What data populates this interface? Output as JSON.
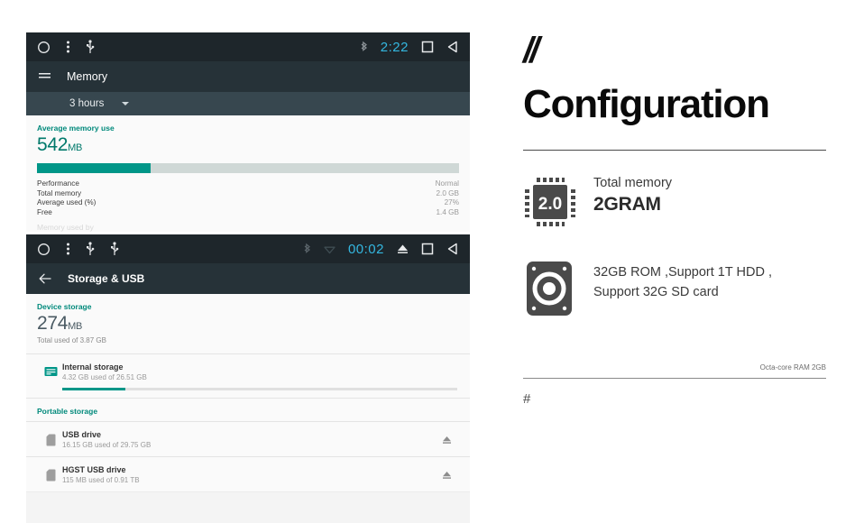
{
  "screenshot_memory": {
    "statusbar": {
      "home_icon": "circle-home-icon",
      "menu_icon": "overflow-menu-icon",
      "usb_icon": "usb-icon",
      "bluetooth_icon": "bluetooth-icon",
      "clock": "2:22",
      "recents_icon": "recents-square-icon",
      "back_icon": "back-triangle-icon"
    },
    "appbar": {
      "menu_icon": "hamburger-icon",
      "title": "Memory"
    },
    "spinner": {
      "value": "3 hours",
      "caret_icon": "chevron-down-icon"
    },
    "section_label": "Average memory use",
    "value": "542",
    "unit": "MB",
    "usage_percent": 27,
    "stats": [
      {
        "label": "Performance",
        "value": "Normal"
      },
      {
        "label": "Total memory",
        "value": "2.0 GB"
      },
      {
        "label": "Average used (%)",
        "value": "27%"
      },
      {
        "label": "Free",
        "value": "1.4 GB"
      }
    ],
    "cut_off_row": "Memory used by"
  },
  "screenshot_storage": {
    "statusbar": {
      "home_icon": "circle-home-icon",
      "menu_icon": "overflow-menu-icon",
      "usb_icon_1": "usb-icon",
      "usb_icon_2": "usb-icon",
      "bluetooth_icon": "bluetooth-icon",
      "wifi_icon": "wifi-icon",
      "clock": "00:02",
      "eject_icon": "eject-icon",
      "recents_icon": "recents-square-icon",
      "back_icon": "back-triangle-icon"
    },
    "appbar": {
      "back_icon": "back-arrow-icon",
      "title": "Storage & USB"
    },
    "device_section_label": "Device storage",
    "device_value": "274",
    "device_unit": "MB",
    "device_subnote": "Total used of 3.87 GB",
    "internal": {
      "icon": "internal-storage-icon",
      "title": "Internal storage",
      "subtitle": "4.32 GB used of 26.51 GB",
      "fill_percent": 16
    },
    "portable_section_label": "Portable storage",
    "portable": [
      {
        "icon": "sd-card-icon",
        "title": "USB drive",
        "subtitle": "16.15 GB used of 29.75 GB",
        "action_icon": "eject-icon"
      },
      {
        "icon": "sd-card-icon",
        "title": "HGST USB drive",
        "subtitle": "115 MB used of 0.91 TB",
        "action_icon": "eject-icon"
      }
    ]
  },
  "panel": {
    "slashes": "//",
    "headline": "Configuration",
    "specs": [
      {
        "icon": "memory-chip-icon",
        "icon_text": "2.0",
        "label": "Total memory",
        "value": "2GRAM"
      },
      {
        "icon": "hard-disk-icon",
        "line1": "32GB ROM ,Support 1T HDD ,",
        "line2": "Support 32G SD card"
      }
    ],
    "footnote": "Octa-core RAM 2GB",
    "hash": "#"
  },
  "colors": {
    "teal": "#009688",
    "teal_dark": "#00796b",
    "statusbar": "#1e262b",
    "appbar": "#263238",
    "spinnerbar": "#37474f",
    "clock_cyan": "#34b7e0"
  }
}
